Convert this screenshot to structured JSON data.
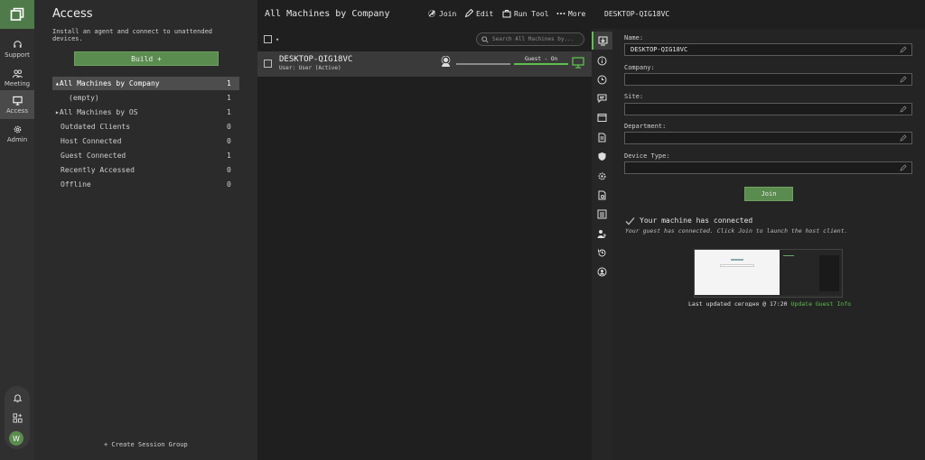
{
  "rail": {
    "items": [
      {
        "label": "Support",
        "icon": "headset-icon"
      },
      {
        "label": "Meeting",
        "icon": "people-icon"
      },
      {
        "label": "Access",
        "icon": "monitor-icon"
      },
      {
        "label": "Admin",
        "icon": "gear-icon"
      }
    ],
    "avatar_initial": "W"
  },
  "access": {
    "title": "Access",
    "description": "Install an agent and connect to unattended devices.",
    "build_label": "Build +",
    "groups": [
      {
        "label": "▴All Machines by Company",
        "count": "1"
      },
      {
        "label": "(empty)",
        "count": "1"
      },
      {
        "label": "▸All Machines by OS",
        "count": "1"
      },
      {
        "label": "Outdated Clients",
        "count": "0"
      },
      {
        "label": "Host Connected",
        "count": "0"
      },
      {
        "label": "Guest Connected",
        "count": "1"
      },
      {
        "label": "Recently Accessed",
        "count": "0"
      },
      {
        "label": "Offline",
        "count": "0"
      }
    ],
    "create_group_label": "+ Create Session Group"
  },
  "list": {
    "title": "All Machines by Company",
    "toolbar": {
      "join": "Join",
      "edit": "Edit",
      "run_tool": "Run Tool",
      "more": "More"
    },
    "search_placeholder": "Search All Machines by...",
    "machine": {
      "name": "DESKTOP-QIG18VC",
      "user": "User: User (Active)",
      "guest_status": "Guest - On"
    }
  },
  "details": {
    "title": "DESKTOP-QIG18VC",
    "fields": {
      "name_label": "Name:",
      "name_value": "DESKTOP-QIG18VC",
      "company_label": "Company:",
      "company_value": "",
      "site_label": "Site:",
      "site_value": "",
      "department_label": "Department:",
      "department_value": "",
      "device_type_label": "Device Type:",
      "device_type_value": ""
    },
    "join_label": "Join",
    "connected_title": "Your machine has connected",
    "connected_message": "Your guest has connected. Click Join to launch the host client.",
    "last_updated": "Last updated сегодня @ 17:20",
    "update_link": "Update Guest Info"
  },
  "colors": {
    "accent": "#5b8c4f",
    "status_green": "#5fbf4f"
  }
}
